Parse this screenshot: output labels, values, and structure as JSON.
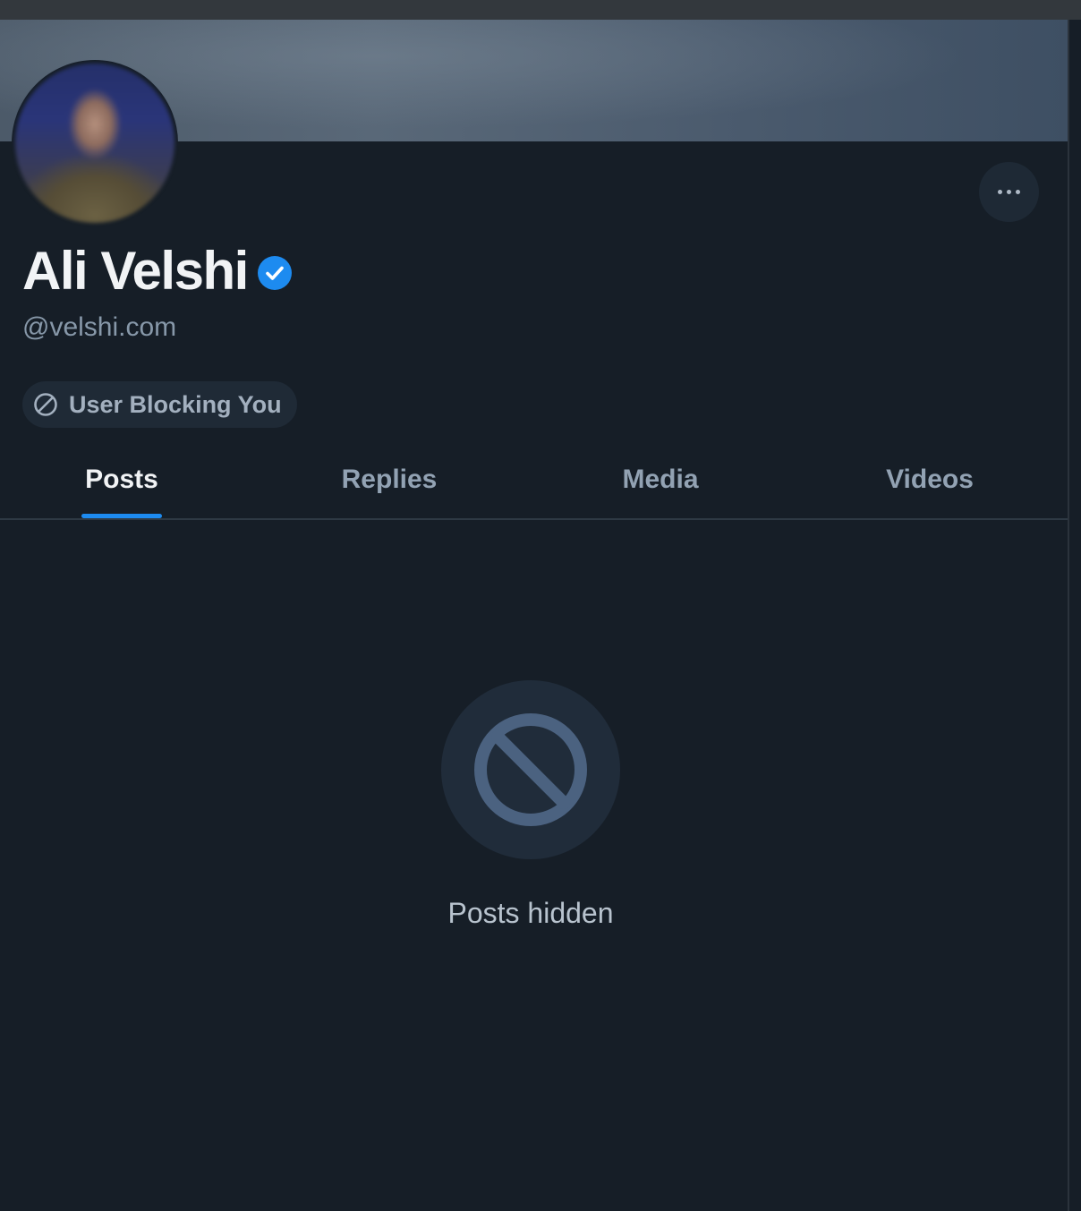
{
  "profile": {
    "display_name": "Ali Velshi",
    "handle": "@velshi.com",
    "verified": true,
    "status_badge": "User Blocking You"
  },
  "icons": {
    "more": "more-dots-icon",
    "verified": "verified-check-icon",
    "block": "block-icon"
  },
  "tabs": [
    {
      "label": "Posts",
      "active": true
    },
    {
      "label": "Replies",
      "active": false
    },
    {
      "label": "Media",
      "active": false
    },
    {
      "label": "Videos",
      "active": false
    }
  ],
  "feed": {
    "empty_message": "Posts hidden"
  },
  "colors": {
    "background": "#161e27",
    "accent": "#1d8bf0",
    "verified_badge": "#1d8bf0",
    "muted_text": "#8798a9"
  }
}
